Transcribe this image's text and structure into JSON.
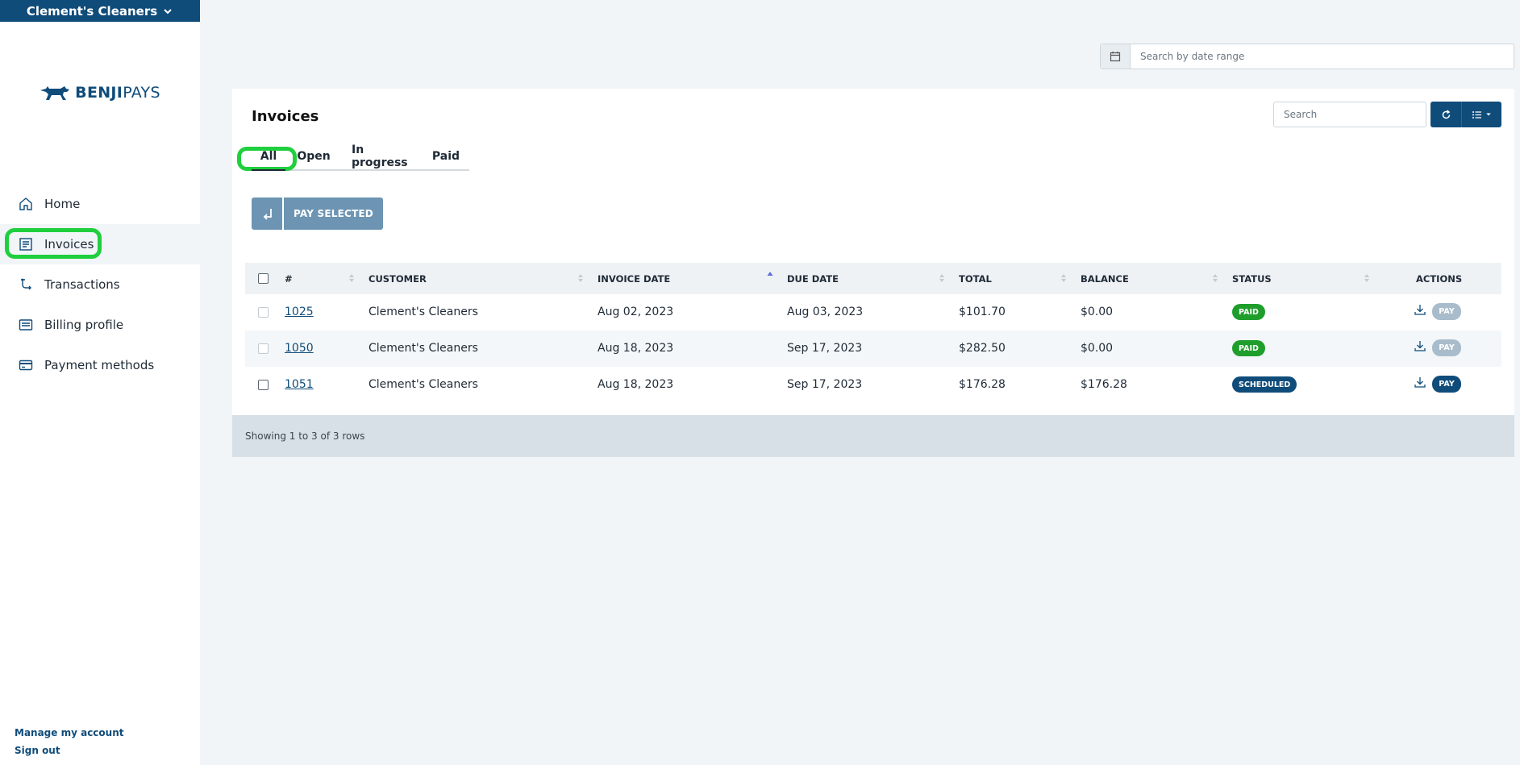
{
  "org": {
    "name": "Clement's Cleaners"
  },
  "logo": {
    "brand_bold": "BENJI",
    "brand_light": "PAYS"
  },
  "nav": {
    "items": [
      {
        "label": "Home"
      },
      {
        "label": "Invoices"
      },
      {
        "label": "Transactions"
      },
      {
        "label": "Billing profile"
      },
      {
        "label": "Payment methods"
      }
    ],
    "active": "Invoices"
  },
  "account": {
    "manage": "Manage my account",
    "signout": "Sign out"
  },
  "date_search": {
    "placeholder": "Search by date range"
  },
  "invoices": {
    "title": "Invoices",
    "tabs": [
      "All",
      "Open",
      "In progress",
      "Paid"
    ],
    "active_tab": "All",
    "search_placeholder": "Search",
    "pay_selected_label": "PAY SELECTED",
    "columns": [
      "#",
      "CUSTOMER",
      "INVOICE DATE",
      "DUE DATE",
      "TOTAL",
      "BALANCE",
      "STATUS",
      "ACTIONS"
    ],
    "sorted_column": "INVOICE DATE",
    "rows": [
      {
        "number": "1025",
        "customer": "Clement's Cleaners",
        "invoice_date": "Aug 02, 2023",
        "due_date": "Aug 03, 2023",
        "total": "$101.70",
        "balance": "$0.00",
        "status": "PAID",
        "pay": "PAY"
      },
      {
        "number": "1050",
        "customer": "Clement's Cleaners",
        "invoice_date": "Aug 18, 2023",
        "due_date": "Sep 17, 2023",
        "total": "$282.50",
        "balance": "$0.00",
        "status": "PAID",
        "pay": "PAY"
      },
      {
        "number": "1051",
        "customer": "Clement's Cleaners",
        "invoice_date": "Aug 18, 2023",
        "due_date": "Sep 17, 2023",
        "total": "$176.28",
        "balance": "$176.28",
        "status": "SCHEDULED",
        "pay": "PAY"
      }
    ],
    "footer": "Showing 1 to 3 of 3 rows"
  },
  "colors": {
    "brand": "#0f4c7a",
    "paid": "#1f9e2c",
    "highlight": "#1fcf3d"
  }
}
